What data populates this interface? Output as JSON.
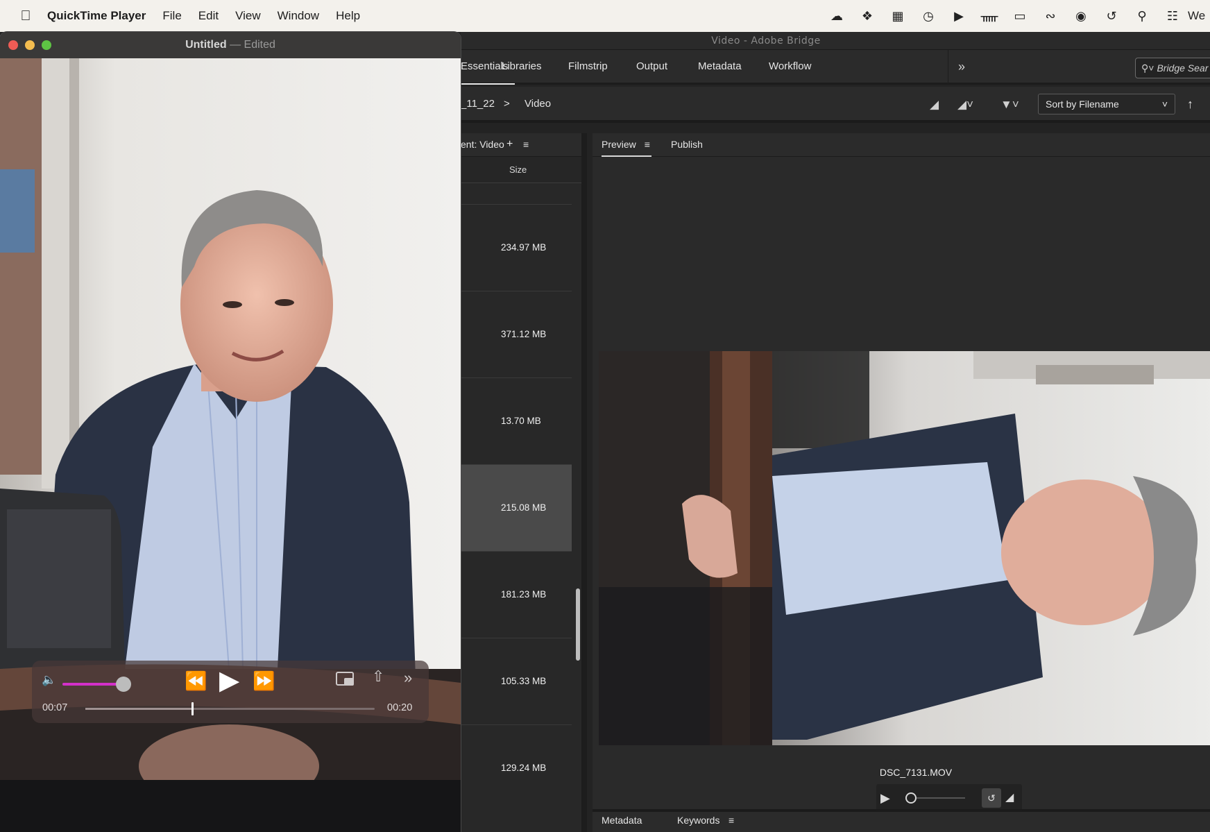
{
  "menubar": {
    "apple_icon": "apple-logo",
    "app_name": "QuickTime Player",
    "menus": [
      "File",
      "Edit",
      "View",
      "Window",
      "Help"
    ],
    "status_icons": [
      "creative-cloud-icon",
      "dropbox-icon",
      "color-app-icon",
      "time-machine-icon",
      "play-icon",
      "bluetooth-icon",
      "battery-icon",
      "wifi-icon",
      "user-icon",
      "history-icon",
      "search-icon",
      "control-center-icon"
    ],
    "clock_partial": "We"
  },
  "bridge": {
    "window_title": "Video - Adobe Bridge",
    "workspace_tabs": [
      "Essentials",
      "Libraries",
      "Filmstrip",
      "Output",
      "Metadata",
      "Workflow"
    ],
    "active_workspace": "Essentials",
    "more_workspaces": "»",
    "search_placeholder": "Bridge Sear",
    "breadcrumb": [
      "_11_22",
      "Video"
    ],
    "breadcrumb_sep": ">",
    "sort_label": "Sort by Filename",
    "content_tab": "ent: Video",
    "size_column_header": "Size",
    "file_sizes": [
      "234.97 MB",
      "371.12 MB",
      "13.70 MB",
      "215.08 MB",
      "181.23 MB",
      "105.33 MB",
      "129.24 MB"
    ],
    "selected_index": 3,
    "preview_tabs": [
      "Preview",
      "Publish"
    ],
    "preview_filename": "DSC_7131.MOV",
    "bottom_tabs": [
      "Metadata",
      "Keywords"
    ]
  },
  "quicktime": {
    "title": "Untitled",
    "title_sep": "—",
    "title_status": "Edited",
    "time_current": "00:07",
    "time_total": "00:20",
    "volume_level": 0.9,
    "playback_progress": 0.37
  },
  "colors": {
    "qt_volume_accent": "#d330c9",
    "bridge_bg": "#232323",
    "menubar_bg": "#f3f1ec"
  }
}
